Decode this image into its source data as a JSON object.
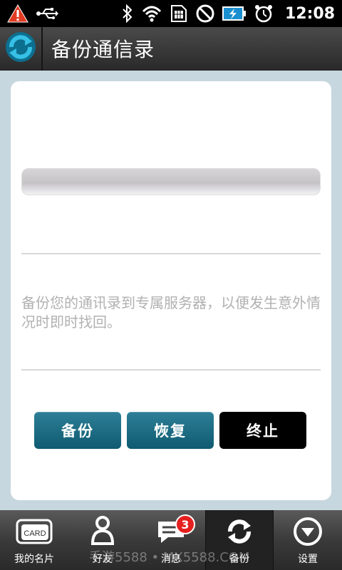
{
  "status_bar": {
    "time": "12:08",
    "icons": [
      "warning-icon",
      "usb-icon",
      "bluetooth-icon",
      "wifi-icon",
      "sim-icon",
      "no-sim-icon",
      "battery-icon",
      "alarm-icon"
    ]
  },
  "title_bar": {
    "title": "备份通信录"
  },
  "content": {
    "description": "备份您的通讯录到专属服务器，以便发生意外情况时即时找回。",
    "buttons": {
      "backup": "备份",
      "restore": "恢复",
      "stop": "终止"
    }
  },
  "bottom_nav": {
    "items": [
      {
        "label": "我的名片",
        "icon": "card-icon"
      },
      {
        "label": "好友",
        "icon": "contact-person-icon"
      },
      {
        "label": "消息",
        "icon": "message-icon",
        "badge": "3"
      },
      {
        "label": "备份",
        "icon": "sync-icon",
        "active": true
      },
      {
        "label": "设置",
        "icon": "settings-icon"
      }
    ]
  },
  "watermark": "手游5588 • MX5588.COM",
  "card_icon_text": "CARD"
}
